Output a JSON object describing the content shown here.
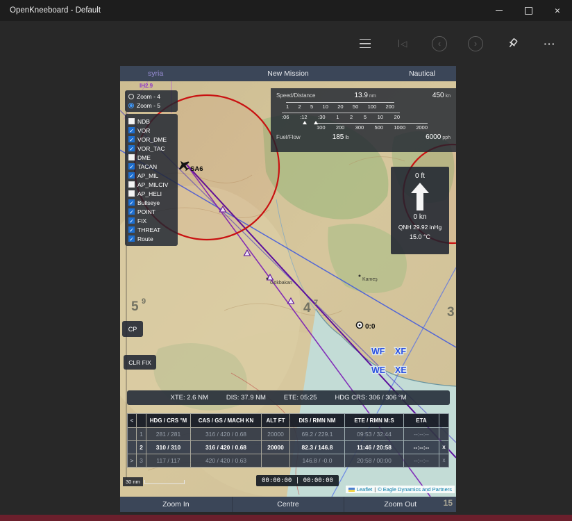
{
  "titlebar": {
    "title": "OpenKneeboard - Default"
  },
  "icons": {
    "close": "×",
    "more": "···",
    "skip_start": "◁",
    "nav_back": "‹",
    "nav_forward": "›",
    "check": "✓"
  },
  "kneeboard": {
    "header": {
      "region": "syria",
      "mission": "New Mission",
      "chart_mode": "Nautical"
    },
    "zoom_options": [
      {
        "label": "Zoom - 4",
        "selected": false
      },
      {
        "label": "Zoom - 5",
        "selected": true
      }
    ],
    "layers": [
      {
        "label": "NDB",
        "checked": false
      },
      {
        "label": "VOR",
        "checked": true
      },
      {
        "label": "VOR_DME",
        "checked": true
      },
      {
        "label": "VOR_TAC",
        "checked": true
      },
      {
        "label": "DME",
        "checked": false
      },
      {
        "label": "TACAN",
        "checked": true
      },
      {
        "label": "AP_MIL",
        "checked": true
      },
      {
        "label": "AP_MILCIV",
        "checked": false
      },
      {
        "label": "AP_HELI",
        "checked": false
      },
      {
        "label": "Bullseye",
        "checked": true
      },
      {
        "label": "POINT",
        "checked": true
      },
      {
        "label": "FIX",
        "checked": true
      },
      {
        "label": "THREAT",
        "checked": true
      },
      {
        "label": "Route",
        "checked": true
      }
    ],
    "speed_panel": {
      "title": "Speed/Distance",
      "distance_value": "13.9",
      "distance_unit": "nm",
      "speed_value": "450",
      "speed_unit": "kn",
      "scale_top": [
        "1",
        "2",
        "5",
        "10",
        "20",
        "50",
        "100",
        "200"
      ],
      "scale_mid": [
        ":06",
        ":12",
        ":30",
        "1",
        "2",
        "5",
        "10",
        "20"
      ],
      "scale_bottom": [
        "100",
        "200",
        "300",
        "500",
        "1000",
        "2000"
      ],
      "fuel_title": "Fuel/Flow",
      "fuel_value": "185",
      "fuel_unit": "lb",
      "flow_value": "6000",
      "flow_unit": "pph"
    },
    "alt_panel": {
      "altitude": "0 ft",
      "speed": "0 kn",
      "qnh": "QNH 29.92 inHg",
      "temperature": "15.0 °C"
    },
    "cp_button": "CP",
    "clr_fix_button": "CLR FIX",
    "map_labels": {
      "threat_site": "SA6",
      "waypoint": "0:0",
      "wf": "WF",
      "xf": "XF",
      "we": "WE",
      "xe": "XE",
      "grid_5": "5",
      "grid_9": "9",
      "grid_4": "4",
      "grid_7": "7",
      "grid_3": "3",
      "grid_15": "15",
      "town_1": "Gökbakan",
      "town_2": "Kameş",
      "airway": "IH2.9"
    },
    "status_bar": [
      "XTE: 2.6 NM",
      "DIS: 37.9 NM",
      "ETE: 05:25",
      "HDG CRS: 306 / 306 °M"
    ],
    "flight_plan": {
      "nav_prev": "<",
      "nav_next": ">",
      "headers": [
        "HDG / CRS °M",
        "CAS / GS / MACH KN",
        "ALT FT",
        "DIS / RMN NM",
        "ETE / RMN M:S",
        "ETA"
      ],
      "rows": [
        {
          "nav": "",
          "num": "1",
          "hdg": "281 / 281",
          "cas": "316 / 420 / 0.68",
          "alt": "20000",
          "dis": "69.2 / 229.1",
          "ete": "09:53 / 32:44",
          "eta": "--:--:--",
          "close": "",
          "active": false
        },
        {
          "nav": "",
          "num": "2",
          "hdg": "310 / 310",
          "cas": "316 / 420 / 0.68",
          "alt": "20000",
          "dis": "82.3 / 146.8",
          "ete": "11:46 / 20:58",
          "eta": "--:--:--",
          "close": "x",
          "active": true
        },
        {
          "nav": ">",
          "num": "3",
          "hdg": "117 / 117",
          "cas": "420 / 420 / 0.63",
          "alt": "",
          "dis": "146.8 / -0.0",
          "ete": "20:58 / 00:00",
          "eta": "--:--:--",
          "close": "x",
          "active": false
        }
      ]
    },
    "scale_bar": "30 nm",
    "clock": "00:00:00 | 00:00:00",
    "attribution": {
      "leaflet": "Leaflet",
      "separator": "|",
      "credit": "© Eagle Dynamics and Partners"
    },
    "footer": [
      "Zoom In",
      "Centre",
      "Zoom Out"
    ]
  },
  "colors": {
    "checkbox_accent": "#1d6fd1",
    "threat_ring": "#c91111",
    "route_purple": "#5c0f9c",
    "airway_blue": "#3c57e0",
    "panel_chrome": "#3b4658",
    "bottom_strip": "#6b1f2c"
  }
}
